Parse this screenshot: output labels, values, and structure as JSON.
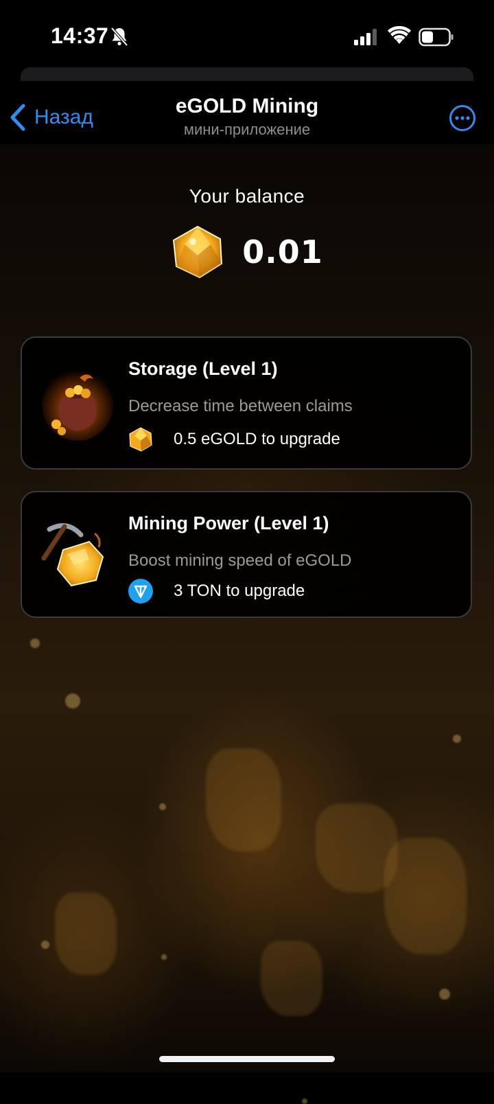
{
  "status_bar": {
    "time": "14:37"
  },
  "nav": {
    "back_label": "Назад",
    "title": "eGOLD Mining",
    "subtitle": "мини-приложение"
  },
  "balance": {
    "label": "Your balance",
    "value": "0.01"
  },
  "upgrades": [
    {
      "title": "Storage (Level 1)",
      "description": "Decrease time between claims",
      "cost": "0.5 eGOLD to upgrade",
      "cost_icon": "egold-gem-icon",
      "image_icon": "gold-sack-icon"
    },
    {
      "title": "Mining Power (Level 1)",
      "description": "Boost mining speed of eGOLD",
      "cost": "3 TON to upgrade",
      "cost_icon": "ton-icon",
      "image_icon": "pickaxe-gold-icon"
    }
  ],
  "colors": {
    "accent_blue": "#2f8ff0",
    "card_border": "#3a3a3c",
    "muted_text": "#9a9a9a",
    "gold": "#f2b531",
    "ton_blue": "#1da1f2"
  }
}
